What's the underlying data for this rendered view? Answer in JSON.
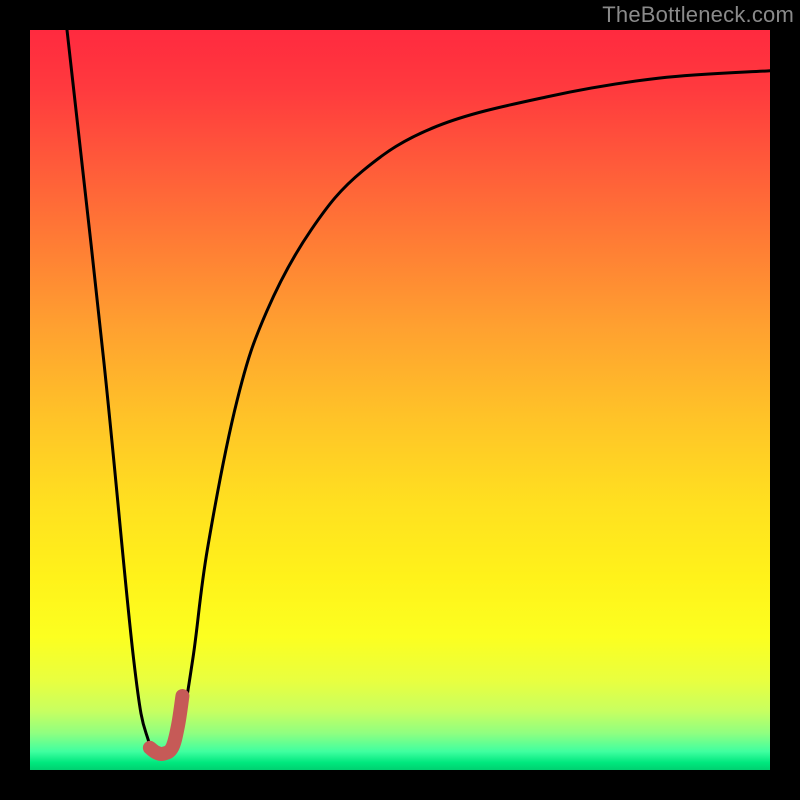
{
  "watermark": "TheBottleneck.com",
  "chart_data": {
    "type": "line",
    "title": "",
    "xlabel": "",
    "ylabel": "",
    "xlim": [
      0,
      100
    ],
    "ylim": [
      0,
      100
    ],
    "series": [
      {
        "name": "bottleneck-curve",
        "x": [
          5,
          10,
          14,
          16,
          18,
          20,
          22,
          24,
          28,
          32,
          38,
          45,
          55,
          70,
          85,
          100
        ],
        "values": [
          100,
          55,
          15,
          4,
          2,
          4,
          15,
          30,
          50,
          62,
          73,
          81,
          87,
          91,
          93.5,
          94.5
        ]
      }
    ],
    "highlight_segment": {
      "name": "optimal-range-marker",
      "x": [
        16.2,
        17.0,
        18.0,
        19.2,
        20.0,
        20.6
      ],
      "values": [
        3.0,
        2.4,
        2.2,
        3.0,
        6.0,
        10.0
      ]
    },
    "colors": {
      "curve": "#000000",
      "highlight": "#c65a57",
      "gradient_top": "#ff2a3f",
      "gradient_bottom": "#00d070"
    }
  }
}
